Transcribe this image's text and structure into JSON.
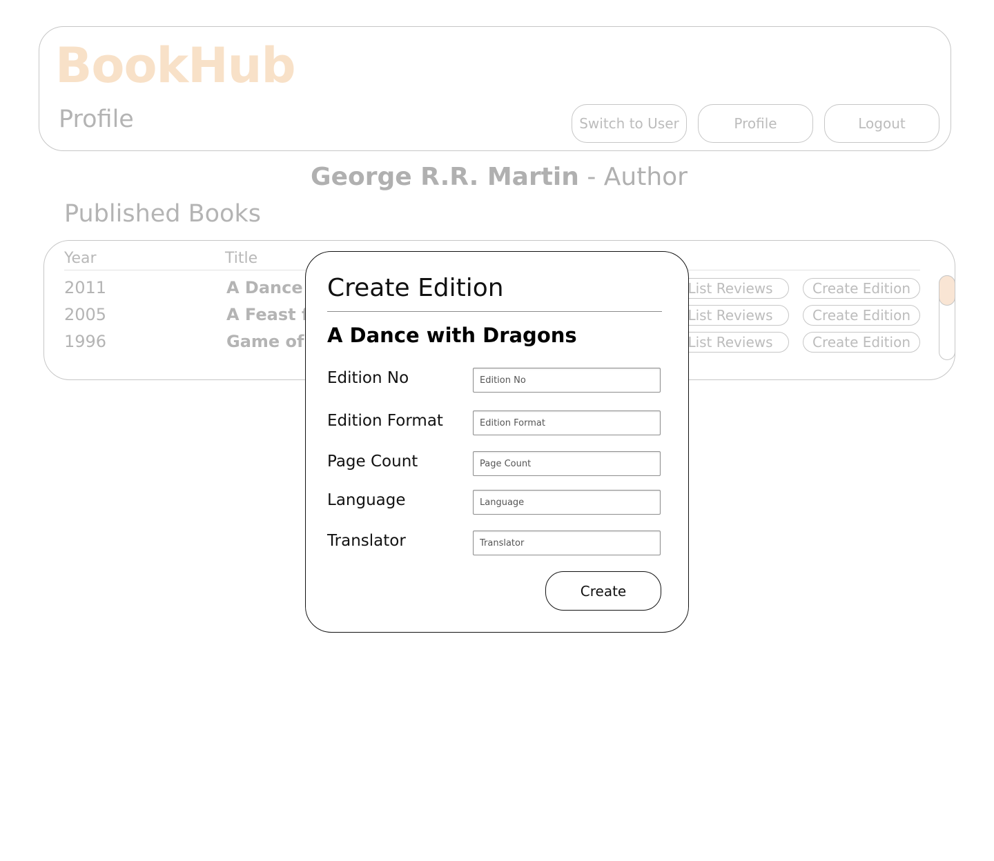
{
  "header": {
    "brand": "BookHub",
    "page_heading": "Profile",
    "buttons": {
      "switch_user": "Switch to User",
      "profile": "Profile",
      "logout": "Logout"
    }
  },
  "author": {
    "name": "George R.R. Martin",
    "role": " - Author"
  },
  "published": {
    "title": "Published Books",
    "columns": {
      "year": "Year",
      "title": "Title"
    },
    "rows": [
      {
        "year": "2011",
        "title": "A Dance w",
        "list_reviews": "List Reviews",
        "create_edition": "Create Edition"
      },
      {
        "year": "2005",
        "title": "A Feast fo",
        "list_reviews": "List Reviews",
        "create_edition": "Create Edition"
      },
      {
        "year": "1996",
        "title": "Game of T",
        "list_reviews": "List Reviews",
        "create_edition": "Create Edition"
      }
    ]
  },
  "modal": {
    "title": "Create Edition",
    "book_title": "A Dance with Dragons",
    "fields": {
      "edition_no": {
        "label": "Edition No",
        "placeholder": "Edition No"
      },
      "edition_format": {
        "label": "Edition Format",
        "placeholder": "Edition Format"
      },
      "page_count": {
        "label": "Page Count",
        "placeholder": "Page Count"
      },
      "language": {
        "label": "Language",
        "placeholder": "Language"
      },
      "translator": {
        "label": "Translator",
        "placeholder": "Translator"
      }
    },
    "submit_label": "Create"
  },
  "colors": {
    "brand": "#f8e1c8",
    "muted_text": "#b4b4b4",
    "scroll_thumb": "#f9e5d4"
  }
}
